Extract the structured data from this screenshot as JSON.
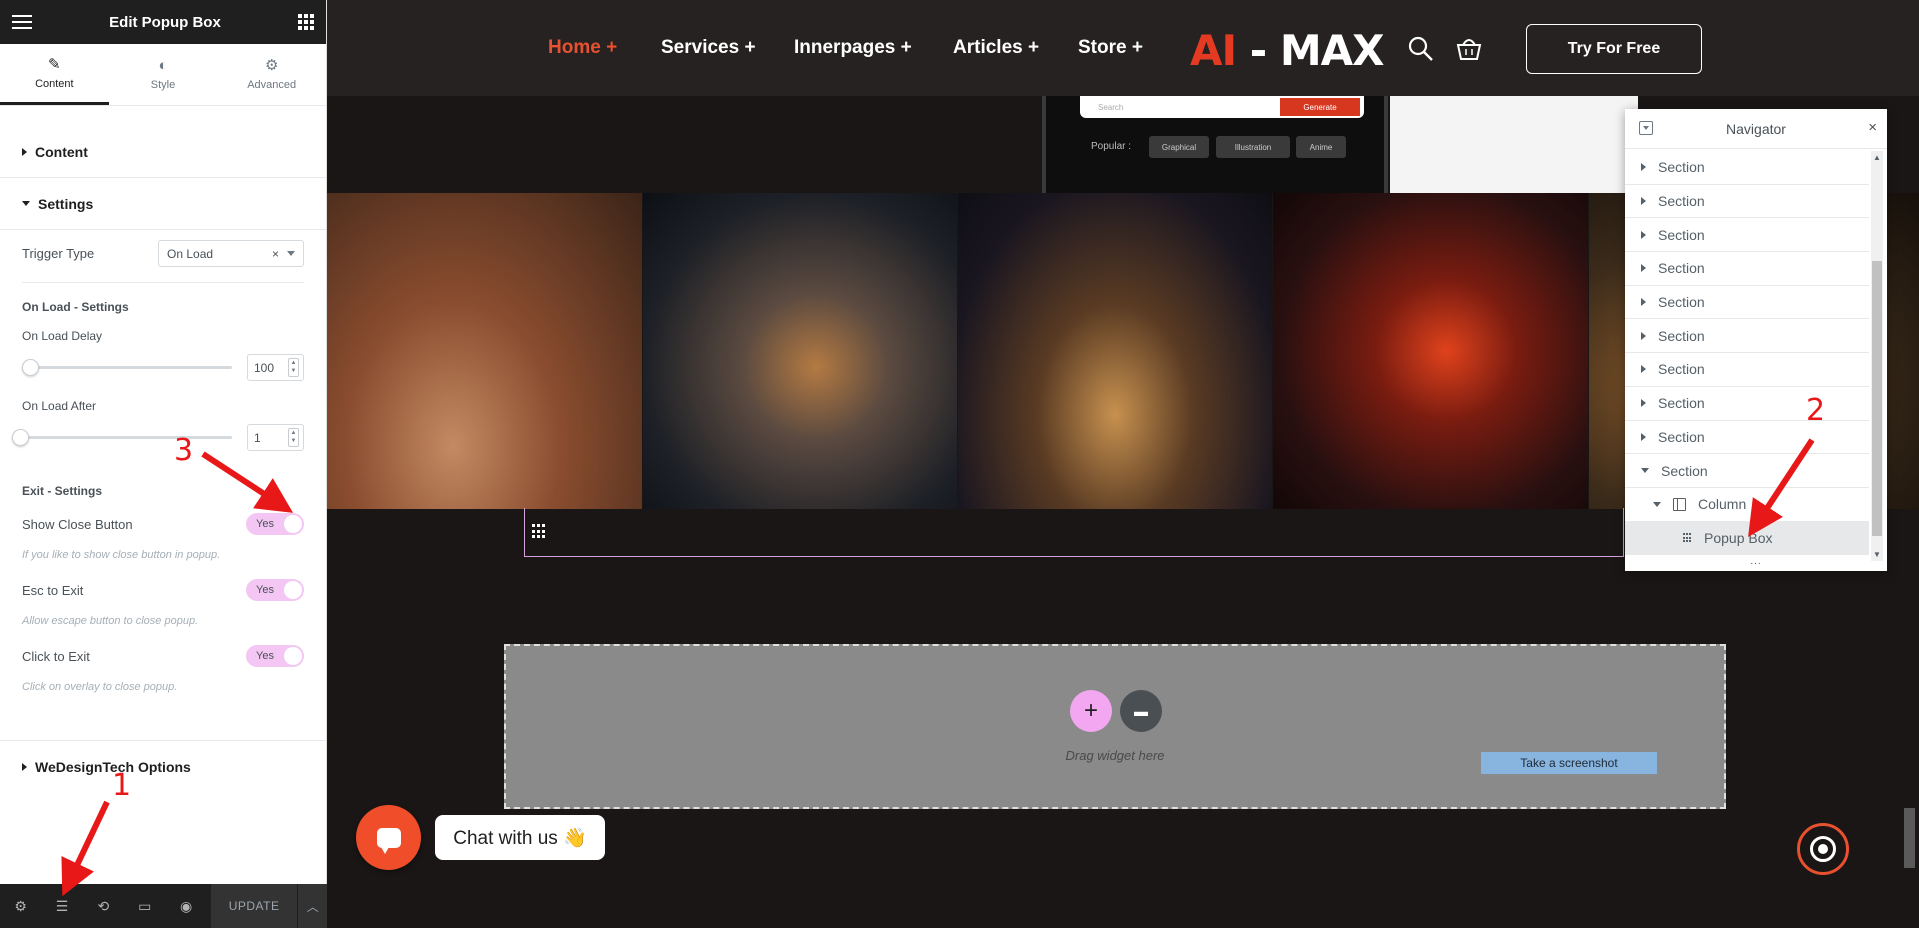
{
  "panel": {
    "title": "Edit Popup Box",
    "tabs": [
      {
        "label": "Content"
      },
      {
        "label": "Style"
      },
      {
        "label": "Advanced"
      }
    ],
    "sections": {
      "content": "Content",
      "settings": "Settings",
      "wedesigntech": "WeDesignTech Options"
    },
    "trigger_type": {
      "label": "Trigger Type",
      "value": "On Load"
    },
    "on_load_settings": {
      "heading": "On Load - Settings",
      "delay_label": "On Load Delay",
      "delay_value": "100",
      "after_label": "On Load After",
      "after_value": "1"
    },
    "exit_settings": {
      "heading": "Exit - Settings",
      "show_close": {
        "label": "Show Close Button",
        "value": "Yes",
        "hint": "If you like to show close button in popup."
      },
      "esc_exit": {
        "label": "Esc to Exit",
        "value": "Yes",
        "hint": "Allow escape button to close popup."
      },
      "click_exit": {
        "label": "Click to Exit",
        "value": "Yes",
        "hint": "Click on overlay to close popup."
      }
    },
    "footer": {
      "update": "UPDATE"
    }
  },
  "site": {
    "nav": [
      {
        "label": "Home +"
      },
      {
        "label": "Services +"
      },
      {
        "label": "Innerpages +"
      },
      {
        "label": "Articles +"
      },
      {
        "label": "Store +"
      }
    ],
    "logo_a": "AI",
    "logo_b": " - MAX",
    "cta": "Try For Free",
    "device": {
      "search_placeholder": "Search",
      "generate": "Generate",
      "popular": "Popular :",
      "chips": [
        "Graphical",
        "Illustration",
        "Anime"
      ]
    },
    "dropzone": {
      "text": "Drag widget here",
      "screenshot": "Take a screenshot"
    },
    "chat": {
      "label": "Chat with us 👋"
    }
  },
  "navigator": {
    "title": "Navigator",
    "sections": [
      "Section",
      "Section",
      "Section",
      "Section",
      "Section",
      "Section",
      "Section",
      "Section",
      "Section",
      "Section"
    ],
    "column": "Column",
    "popup_box": "Popup Box",
    "resize": "..."
  },
  "annotations": {
    "one": "1",
    "two": "2",
    "three": "3"
  },
  "colors": {
    "accent": "#e8512f",
    "toggle": "#f3c6f3",
    "annotation": "#e81818"
  }
}
